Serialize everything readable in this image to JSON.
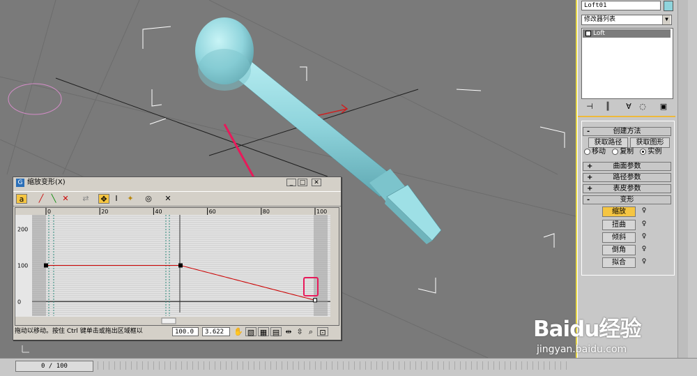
{
  "panel": {
    "object_name": "Loft01",
    "modifier_list": "修改器列表",
    "stack_item": "Loft",
    "creation_method": {
      "header": "创建方法",
      "get_path": "获取路径",
      "get_shape": "获取图形",
      "options": [
        "移动",
        "复制",
        "实例"
      ],
      "selected": "实例"
    },
    "rollouts": [
      {
        "sign": "+",
        "title": "曲面参数"
      },
      {
        "sign": "+",
        "title": "路径参数"
      },
      {
        "sign": "+",
        "title": "表皮参数"
      },
      {
        "sign": "-",
        "title": "变形"
      }
    ],
    "deform_buttons": [
      "缩放",
      "扭曲",
      "倾斜",
      "倒角",
      "拟合"
    ],
    "active_deform": "缩放",
    "accent_color": "#f5c542"
  },
  "dialog": {
    "title": "缩放变形(X)",
    "ruler_labels": [
      "0",
      "20",
      "40",
      "60",
      "80",
      "100"
    ],
    "y_labels": [
      "200",
      "100",
      "0"
    ],
    "status_text": "拖动以移动。按住 Ctrl 键单击或拖出区域框以",
    "x_value": "100.0",
    "y_value": "3.622"
  },
  "chart_data": {
    "type": "line",
    "title": "",
    "xlabel": "",
    "ylabel": "",
    "x": [
      0,
      50,
      100
    ],
    "y": [
      100,
      100,
      3.622
    ],
    "xlim": [
      0,
      100
    ],
    "ylim": [
      -40,
      240
    ]
  },
  "timeline": {
    "frame": "0 / 100"
  },
  "watermark": {
    "brand": "Baidu经验",
    "url": "jingyan.baidu.com"
  },
  "colors": {
    "viewport_bg": "#7a7a7a",
    "object_color": "#8fd4dc",
    "arrow_color": "#e8195a",
    "curve_color": "#cc0000"
  }
}
